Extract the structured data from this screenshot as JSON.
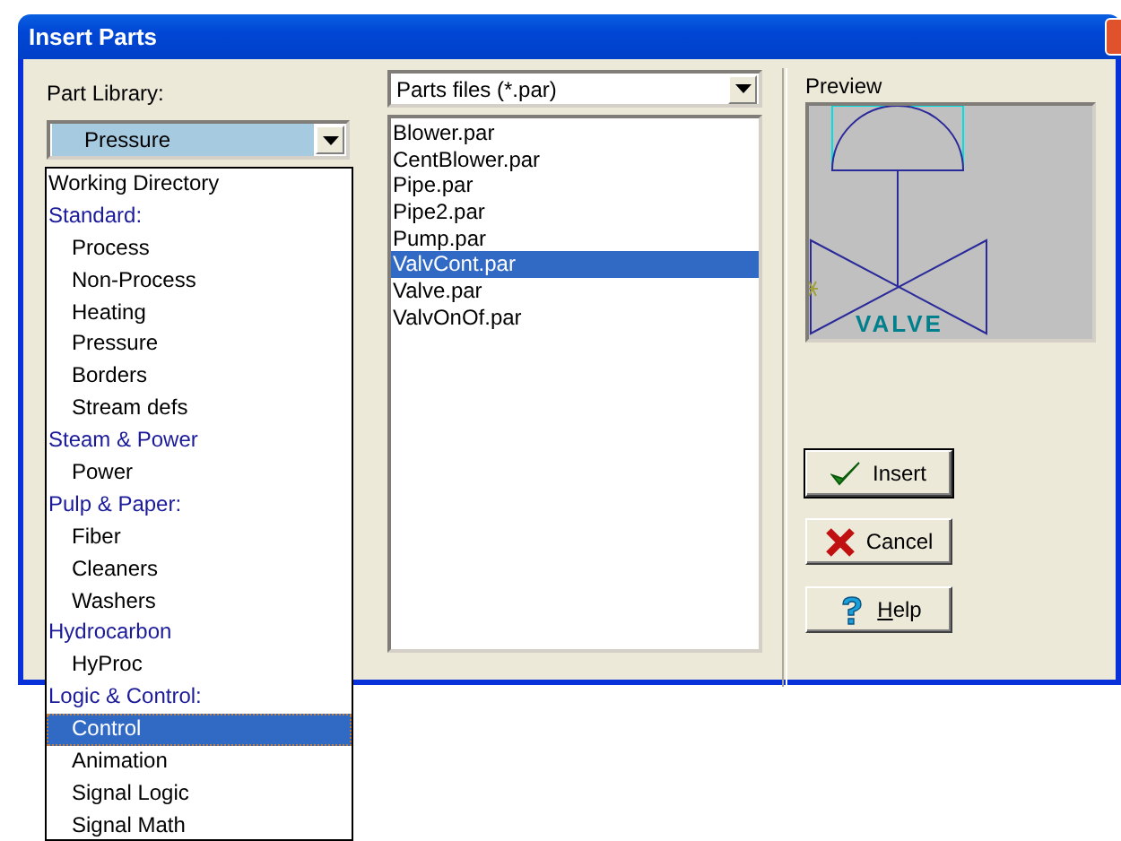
{
  "window": {
    "title": "Insert Parts"
  },
  "part_library": {
    "label": "Part Library:",
    "value": "Pressure",
    "items": [
      {
        "kind": "item",
        "label": "Working Directory",
        "selected": false
      },
      {
        "kind": "group",
        "label": "Standard:",
        "selected": false,
        "children": [
          {
            "label": "Process",
            "selected": false
          },
          {
            "label": "Non-Process",
            "selected": false
          },
          {
            "label": "Heating",
            "selected": false
          },
          {
            "label": "Pressure",
            "selected": false
          },
          {
            "label": "Borders",
            "selected": false
          },
          {
            "label": "Stream defs",
            "selected": false
          }
        ]
      },
      {
        "kind": "group",
        "label": "Steam & Power",
        "selected": false,
        "children": [
          {
            "label": "Power",
            "selected": false
          }
        ]
      },
      {
        "kind": "group",
        "label": "Pulp & Paper:",
        "selected": false,
        "children": [
          {
            "label": "Fiber",
            "selected": false
          },
          {
            "label": "Cleaners",
            "selected": false
          },
          {
            "label": "Washers",
            "selected": false
          }
        ]
      },
      {
        "kind": "group",
        "label": "Hydrocarbon",
        "selected": false,
        "children": [
          {
            "label": "HyProc",
            "selected": false
          }
        ]
      },
      {
        "kind": "group",
        "label": "Logic & Control:",
        "selected": false,
        "children": [
          {
            "label": "Control",
            "selected": true
          },
          {
            "label": "Animation",
            "selected": false
          },
          {
            "label": "Signal Logic",
            "selected": false
          },
          {
            "label": "Signal Math",
            "selected": false
          }
        ]
      }
    ]
  },
  "files": {
    "filter": "Parts files (*.par)",
    "items": [
      {
        "label": "Blower.par",
        "selected": false
      },
      {
        "label": "CentBlower.par",
        "selected": false
      },
      {
        "label": "Pipe.par",
        "selected": false
      },
      {
        "label": "Pipe2.par",
        "selected": false
      },
      {
        "label": "Pump.par",
        "selected": false
      },
      {
        "label": "ValvCont.par",
        "selected": true
      },
      {
        "label": "Valve.par",
        "selected": false
      },
      {
        "label": "ValvOnOf.par",
        "selected": false
      }
    ]
  },
  "preview": {
    "label": "Preview",
    "drawing_label": "VALVE"
  },
  "buttons": [
    {
      "kind": "insert",
      "label": "Insert"
    },
    {
      "kind": "cancel",
      "label": "Cancel"
    },
    {
      "kind": "help",
      "label": "Help"
    }
  ]
}
